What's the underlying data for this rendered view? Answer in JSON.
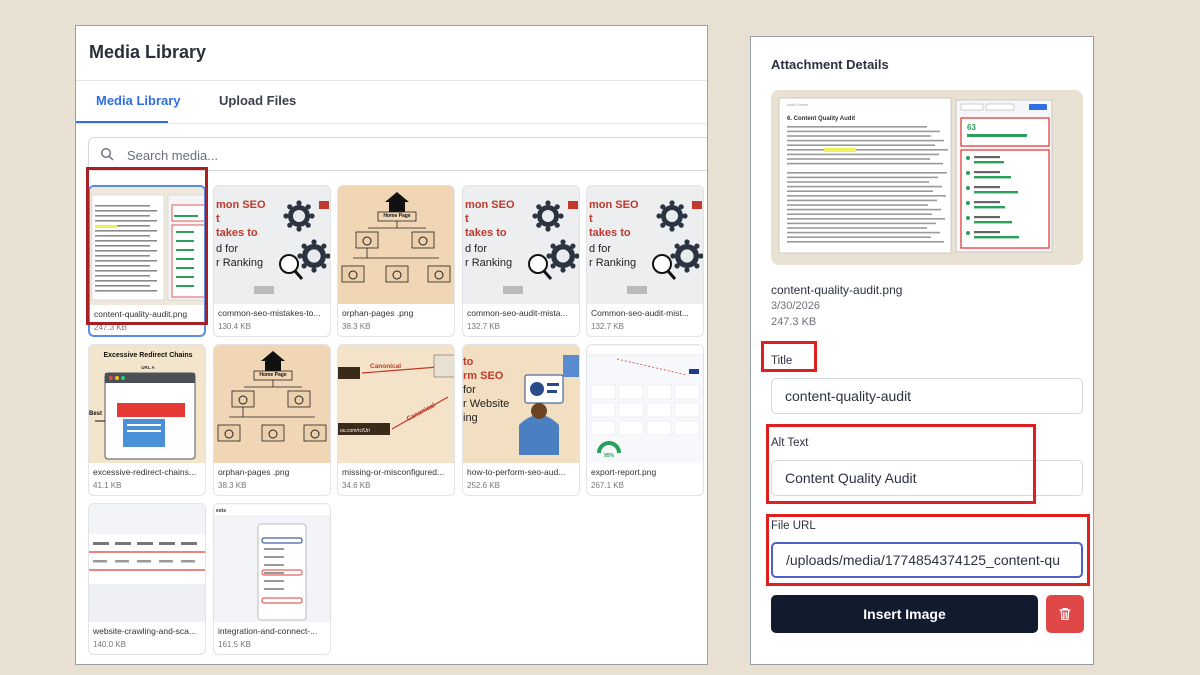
{
  "library": {
    "title": "Media Library",
    "tabs": [
      {
        "label": "Media Library",
        "active": true
      },
      {
        "label": "Upload Files",
        "active": false
      }
    ],
    "search_placeholder": "Search media...",
    "items": [
      {
        "name": "content-quality-audit.png",
        "size": "247.3 KB",
        "selected": true,
        "thumb": "audit"
      },
      {
        "name": "common-seo-mistakes-to...",
        "size": "130.4 KB",
        "thumb": "seo"
      },
      {
        "name": "orphan-pages .png",
        "size": "38.3 KB",
        "thumb": "orphan"
      },
      {
        "name": "common-seo-audit-mista...",
        "size": "132.7 KB",
        "thumb": "seo"
      },
      {
        "name": "Common-seo-audit-mist...",
        "size": "132.7 KB",
        "thumb": "seo"
      },
      {
        "name": "excessive-redirect-chains...",
        "size": "41.1 KB",
        "thumb": "redirect"
      },
      {
        "name": "orphan-pages .png",
        "size": "38.3 KB",
        "thumb": "orphan"
      },
      {
        "name": "missing-or-misconfigured...",
        "size": "34.6 KB",
        "thumb": "canonical"
      },
      {
        "name": "how-to-perform-seo-aud...",
        "size": "252.6 KB",
        "thumb": "perform"
      },
      {
        "name": "export-report.png",
        "size": "267.1 KB",
        "thumb": "report"
      },
      {
        "name": "website-crawling-and-sca...",
        "size": "140.0 KB",
        "thumb": "crawl"
      },
      {
        "name": "integration-and-connect-...",
        "size": "161.5 KB",
        "thumb": "integration"
      }
    ],
    "thumb_text": {
      "seo": [
        "mon SEO",
        "t",
        "takes to",
        "d for",
        "r Ranking"
      ],
      "orphan": [
        "Home Page"
      ],
      "redirect": [
        "Excessive Redirect Chains",
        "URL A",
        "Best"
      ],
      "canonical": [
        "Canonical",
        "Canonical"
      ],
      "perform": [
        "to",
        "rm SEO",
        "for",
        "r Website",
        "ing"
      ]
    }
  },
  "details": {
    "title": "Attachment Details",
    "filename": "content-quality-audit.png",
    "date": "3/30/2026",
    "size": "247.3 KB",
    "preview_heading": "6. Content Quality Audit",
    "title_label": "Title",
    "title_value": "content-quality-audit",
    "alt_label": "Alt Text",
    "alt_value": "Content Quality Audit",
    "url_label": "File URL",
    "url_value": "/uploads/media/1774854374125_content-qu",
    "insert_label": "Insert Image"
  },
  "colors": {
    "accent": "#2f6fe0",
    "highlight_red": "#e02020",
    "dark_red": "#a92024",
    "insert_button": "#121a2e",
    "delete_button": "#e04848",
    "background": "#e8e0d2"
  }
}
